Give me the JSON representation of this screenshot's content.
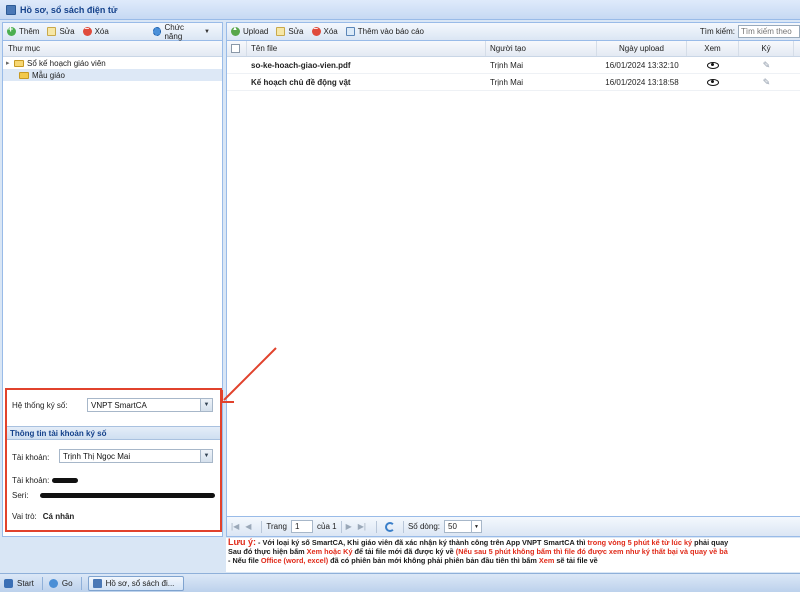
{
  "window": {
    "title": "Hồ sơ, sổ sách điện tử"
  },
  "left_toolbar": {
    "add": "Thêm",
    "edit": "Sửa",
    "delete": "Xóa",
    "functions": "Chức năng"
  },
  "tree": {
    "header": "Thư mục",
    "root": "Sổ kế hoạch giáo viên",
    "child": "Mẫu giáo"
  },
  "right_toolbar": {
    "upload": "Upload",
    "edit": "Sửa",
    "delete": "Xóa",
    "add_report": "Thêm vào báo cáo",
    "search_label": "Tìm kiếm:",
    "search_placeholder": "Tìm kiếm theo"
  },
  "grid": {
    "columns": {
      "file": "Tên file",
      "creator": "Người tạo",
      "date": "Ngày upload",
      "view": "Xem",
      "sign": "Ký"
    },
    "rows": [
      {
        "file": "so-ke-hoach-giao-vien.pdf",
        "creator": "Trịnh Mai",
        "date": "16/01/2024 13:32:10"
      },
      {
        "file": "Kế hoạch chủ đề động vật",
        "creator": "Trịnh Mai",
        "date": "16/01/2024 13:18:58"
      }
    ]
  },
  "sign_panel": {
    "system_label": "Hệ thống ký số:",
    "system_value": "VNPT SmartCA",
    "section_title": "Thông tin tài khoản ký số",
    "account_label": "Tài khoản:",
    "account_value": "Trịnh Thị Ngọc Mai",
    "account2_label": "Tài khoản:",
    "serial_label": "Seri:",
    "role_label": "Vai trò:",
    "role_value": "Cá nhân"
  },
  "pager": {
    "page_label": "Trang",
    "page_value": "1",
    "of_label": "của 1",
    "rows_label": "Số dòng:",
    "rows_value": "50"
  },
  "notes": {
    "lead": "Lưu ý:",
    "l1a": " - Với loại ký số SmartCA, Khi giáo viên đã xác nhận ký thành công trên App VNPT SmartCA thì ",
    "l1b": "trong vòng 5 phút kể từ lúc ký",
    "l1c": " phải quay",
    "l2a": "Sau đó thực hiện bấm ",
    "l2b": "Xem hoặc Ký",
    "l2c": " để tải file mới đã được ký về ",
    "l2d": "(Nếu sau 5 phút không bấm thì file đó được xem như ký thất bại và quay về bả",
    "l3a": "- Nếu file ",
    "l3b": "Office (word, excel)",
    "l3c": " đã có phiên bản mới không phải phiên bản đầu tiên thì bấm ",
    "l3d": "Xem",
    "l3e": " sẽ tải file về"
  },
  "taskbar": {
    "start": "Start",
    "go": "Go",
    "window": "Hồ sơ, sổ sách đi..."
  }
}
